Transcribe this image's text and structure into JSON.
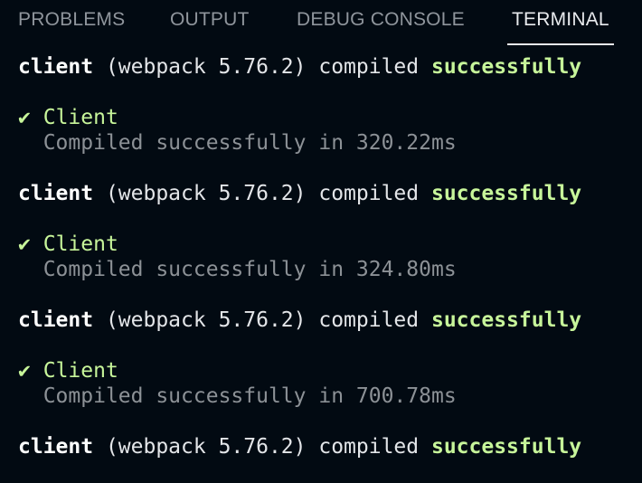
{
  "tabs": [
    {
      "label": "PROBLEMS",
      "active": false
    },
    {
      "label": "OUTPUT",
      "active": false
    },
    {
      "label": "DEBUG CONSOLE",
      "active": false
    },
    {
      "label": "TERMINAL",
      "active": true
    }
  ],
  "terminal": {
    "compile_lines": [
      {
        "name": "client",
        "detail": " (webpack 5.76.2) compiled ",
        "status": "successfully"
      },
      {
        "name": "client",
        "detail": " (webpack 5.76.2) compiled ",
        "status": "successfully"
      },
      {
        "name": "client",
        "detail": " (webpack 5.76.2) compiled ",
        "status": "successfully"
      },
      {
        "name": "client",
        "detail": " (webpack 5.76.2) compiled ",
        "status": "successfully"
      }
    ],
    "client_blocks": [
      {
        "check": "✔",
        "title": "Client",
        "message": "Compiled successfully in 320.22ms"
      },
      {
        "check": "✔",
        "title": "Client",
        "message": "Compiled successfully in 324.80ms"
      },
      {
        "check": "✔",
        "title": "Client",
        "message": "Compiled successfully in 700.78ms"
      }
    ]
  },
  "colors": {
    "background": "#020a12",
    "success": "#c7f59a",
    "dim": "#8c9196",
    "tab_inactive": "#8f959c",
    "tab_active": "#e8eaed"
  }
}
